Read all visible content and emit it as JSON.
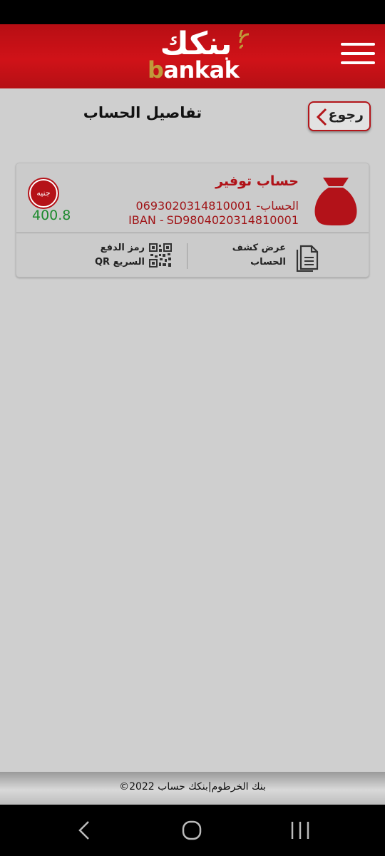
{
  "header": {
    "logo_ar": "بنكك",
    "logo_en_b": "b",
    "logo_en_rest": "ankak"
  },
  "page": {
    "title": "تفاصيل الحساب",
    "back_label": "رجوع"
  },
  "account": {
    "name": "حساب توفير",
    "number_label": "الحساب-",
    "number": "0693020314810001",
    "iban_label": "IBAN -",
    "iban": "SD9804020314810001",
    "currency": "جنيه",
    "balance": "400.8",
    "actions": {
      "statement_line1": "عرض كشف",
      "statement_line2": "الحساب",
      "qr_line1": "رمز الدفع",
      "qr_line2": "السريع QR"
    }
  },
  "footer": {
    "copyright": "©2022 بنك الخرطوم|بنكك حساب"
  },
  "colors": {
    "brand_red": "#c5121a",
    "gold": "#c09a3a",
    "balance_green": "#1d8a2e",
    "background": "#cfcfcf"
  },
  "icons": [
    "menu-icon",
    "chevron-left-icon",
    "money-bag-icon",
    "document-icon",
    "qr-code-icon",
    "nav-back-icon",
    "nav-home-icon",
    "nav-recent-icon",
    "wifi-signal-icon"
  ]
}
